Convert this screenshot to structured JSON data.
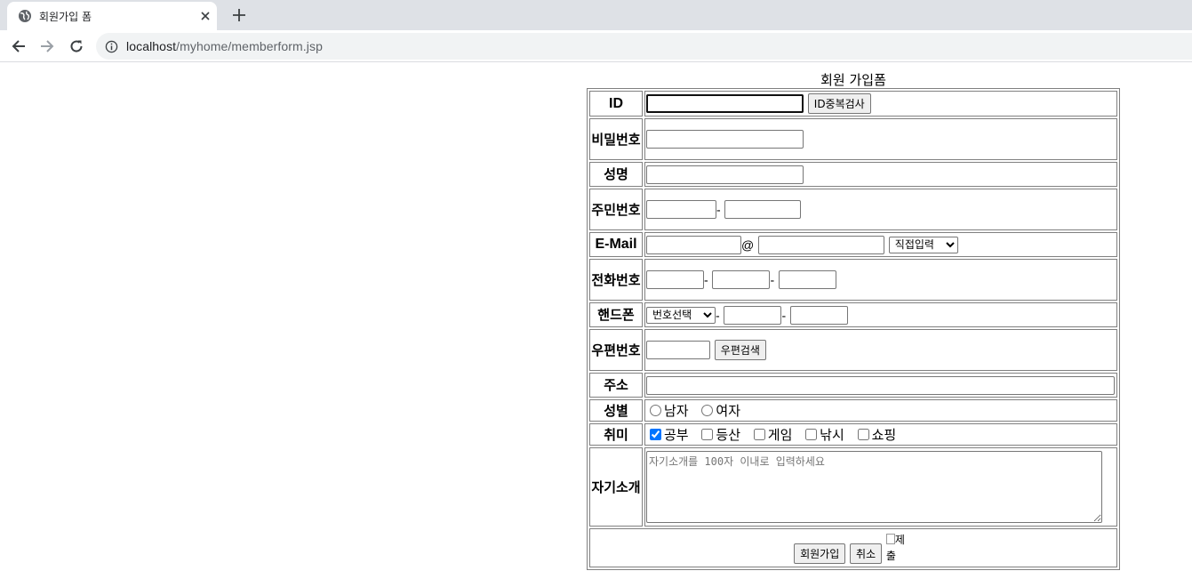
{
  "browser": {
    "tab_title": "회원가입 폼",
    "url_host": "localhost",
    "url_path": "/myhome/memberform.jsp"
  },
  "form": {
    "caption": "회원 가입폼",
    "labels": {
      "id": "ID",
      "password": "비밀번호",
      "name": "성명",
      "resident": "주민번호",
      "email": "E-Mail",
      "phone": "전화번호",
      "mobile": "핸드폰",
      "zip": "우편번호",
      "address": "주소",
      "gender": "성별",
      "hobby": "취미",
      "intro": "자기소개"
    },
    "id_check_button": "ID중복검사",
    "email_at": "@",
    "email_domain_select": "직접입력",
    "dash": "-",
    "mobile_select": "번호선택",
    "zip_search_button": "우편검색",
    "gender_options": [
      "남자",
      "여자"
    ],
    "hobby_options": [
      "공부",
      "등산",
      "게임",
      "낚시",
      "쇼핑"
    ],
    "hobby_checked": [
      "공부"
    ],
    "intro_placeholder": "자기소개를 100자 이내로 입력하세요",
    "submit_button": "회원가입",
    "cancel_button": "취소",
    "image_alt": "제출"
  }
}
